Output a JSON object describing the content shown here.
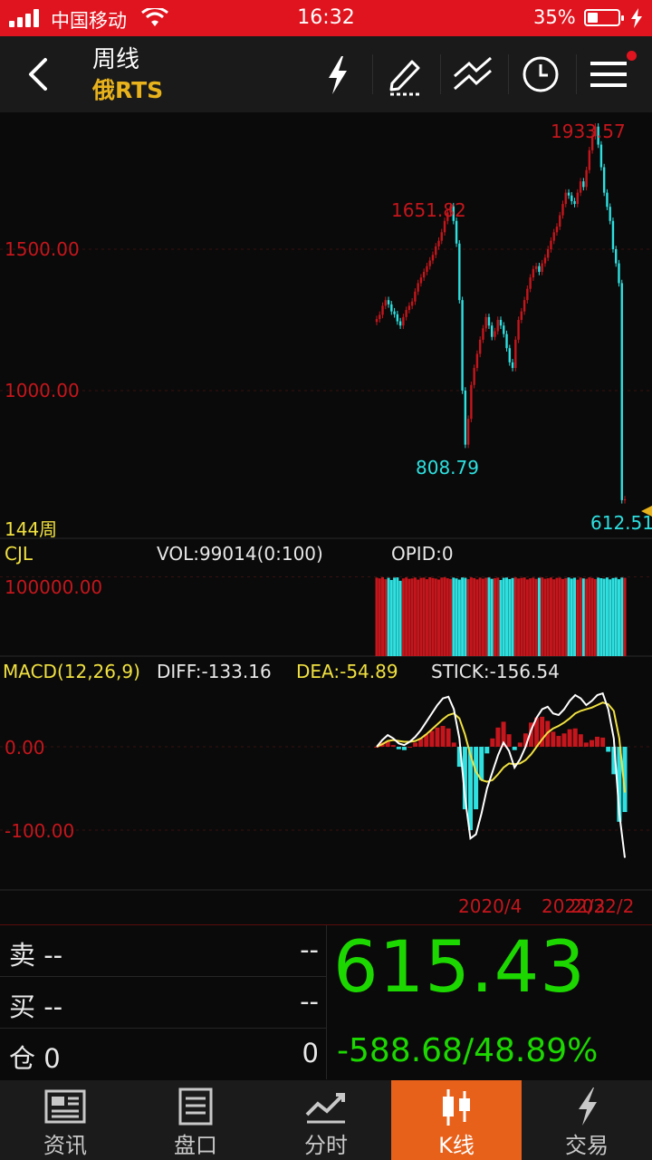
{
  "status_bar": {
    "carrier": "中国移动",
    "time": "16:32",
    "battery_percent": "35%",
    "battery_level": 0.35
  },
  "header": {
    "title": "周线",
    "subtitle": "俄RTS",
    "icons": [
      "back-icon",
      "lightning-icon",
      "pen-icon",
      "trend-lines-icon",
      "clock-icon",
      "menu-icon"
    ],
    "notification_dot_color": "#e0141e"
  },
  "chart_data": [
    {
      "type": "candlestick",
      "period_label": "144周",
      "y_ticks": [
        "1500.00",
        "1000.00"
      ],
      "ylim": [
        612.51,
        1933.57
      ],
      "annotations": {
        "high": "1933.57",
        "local_high": "1651.82",
        "local_low": "808.79",
        "low": "612.51"
      },
      "series": [
        {
          "name": "RTS",
          "values": [
            1253,
            1268,
            1300,
            1320,
            1305,
            1280,
            1270,
            1245,
            1230,
            1260,
            1285,
            1300,
            1315,
            1350,
            1380,
            1400,
            1420,
            1440,
            1460,
            1480,
            1510,
            1530,
            1560,
            1600,
            1630,
            1651.82,
            1600,
            1520,
            1320,
            1000,
            808.79,
            900,
            1020,
            1080,
            1130,
            1180,
            1220,
            1260,
            1230,
            1190,
            1210,
            1250,
            1230,
            1200,
            1150,
            1100,
            1080,
            1180,
            1250,
            1280,
            1320,
            1360,
            1400,
            1430,
            1440,
            1420,
            1450,
            1470,
            1500,
            1530,
            1560,
            1580,
            1620,
            1660,
            1700,
            1690,
            1670,
            1660,
            1700,
            1740,
            1720,
            1780,
            1850,
            1900,
            1933.57,
            1870,
            1790,
            1700,
            1650,
            1600,
            1500,
            1450,
            1380,
            612.51,
            615.43
          ],
          "up_color": "#c4161c",
          "down_color": "#2ee0e0"
        }
      ]
    },
    {
      "type": "bar",
      "indicator": "CJL",
      "info": "VOL:99014(0:100)",
      "opid": "OPID:0",
      "y_ticks": [
        "100000.00"
      ],
      "ylim": [
        0,
        120000
      ],
      "series": [
        {
          "name": "VOL",
          "values": [
            99014,
            98000,
            99500,
            97000,
            98800,
            96000,
            99000,
            99300,
            95000,
            98000,
            99200,
            97500,
            98000,
            99100,
            96500,
            98700,
            99000,
            97000,
            99500,
            98500,
            97800,
            96600,
            99100,
            99400,
            98200,
            97300,
            99014,
            98000,
            96500,
            99200,
            98800,
            97100,
            99300,
            98400,
            96800,
            99000,
            97700,
            98900,
            99200,
            97500,
            98300,
            99000,
            96000,
            98800,
            99100,
            97200,
            98500,
            99300,
            97900,
            98600,
            99200,
            96700,
            98100,
            99000,
            97400,
            98800,
            99300,
            97600,
            98200,
            99100,
            96900,
            98700,
            99000,
            97300,
            98400,
            99200,
            97800,
            98900,
            96400,
            99100,
            98000,
            97500,
            99300,
            98600,
            97200,
            99000,
            98300,
            97700,
            99200,
            96800,
            98500,
            99014,
            97000,
            99100,
            98800
          ]
        }
      ]
    },
    {
      "type": "line",
      "indicator": "MACD(12,26,9)",
      "diff_label": "DIFF:-133.16",
      "dea_label": "DEA:-54.89",
      "stick_label": "STICK:-156.54",
      "y_ticks": [
        "0.00",
        "-100.00"
      ],
      "ylim": [
        -170,
        80
      ],
      "x_ticks": [
        "2020/4",
        "2022/3",
        "2022/2"
      ],
      "series": [
        {
          "name": "DIFF",
          "color": "#ffffff",
          "values": [
            0,
            8,
            14,
            10,
            4,
            2,
            6,
            12,
            20,
            30,
            40,
            50,
            58,
            60,
            45,
            10,
            -60,
            -110,
            -105,
            -80,
            -50,
            -30,
            -10,
            5,
            -5,
            -25,
            -15,
            0,
            20,
            35,
            45,
            48,
            40,
            38,
            45,
            55,
            62,
            58,
            50,
            55,
            62,
            64,
            45,
            10,
            -80,
            -133.16
          ]
        },
        {
          "name": "DEA",
          "color": "#f0e040",
          "values": [
            0,
            3,
            7,
            8,
            7,
            6,
            6,
            7,
            10,
            15,
            21,
            27,
            33,
            38,
            40,
            34,
            15,
            -10,
            -30,
            -40,
            -42,
            -40,
            -33,
            -25,
            -20,
            -21,
            -20,
            -16,
            -9,
            0,
            9,
            17,
            22,
            25,
            29,
            34,
            40,
            43,
            45,
            47,
            50,
            53,
            51,
            43,
            10,
            -54.89
          ]
        },
        {
          "name": "STICK",
          "up_color": "#c4161c",
          "down_color": "#2ee0e0",
          "values": [
            0,
            10,
            14,
            4,
            -6,
            -8,
            0,
            10,
            20,
            30,
            38,
            46,
            50,
            44,
            10,
            -48,
            -150,
            -200,
            -150,
            -80,
            -16,
            20,
            46,
            60,
            30,
            -8,
            10,
            32,
            58,
            70,
            72,
            62,
            36,
            26,
            32,
            42,
            44,
            30,
            10,
            16,
            24,
            22,
            -12,
            -66,
            -180,
            -156.54
          ]
        }
      ]
    }
  ],
  "quote": {
    "sell_label": "卖 --",
    "sell_right": "--",
    "buy_label": "买 --",
    "buy_right": "--",
    "position_label": "仓 0",
    "position_right": "0",
    "last_price": "615.43",
    "change": "-588.68/48.89%",
    "price_color": "#1cd800"
  },
  "tabs": [
    {
      "label": "资讯",
      "icon": "newspaper-icon",
      "active": false
    },
    {
      "label": "盘口",
      "icon": "order-book-icon",
      "active": false
    },
    {
      "label": "分时",
      "icon": "intraday-chart-icon",
      "active": false
    },
    {
      "label": "K线",
      "icon": "candlestick-icon",
      "active": true
    },
    {
      "label": "交易",
      "icon": "lightning-icon",
      "active": false
    }
  ],
  "colors": {
    "accent": "#e8611a",
    "up": "#c4161c",
    "down": "#2ee0e0",
    "header_subtitle": "#e8b21c"
  }
}
